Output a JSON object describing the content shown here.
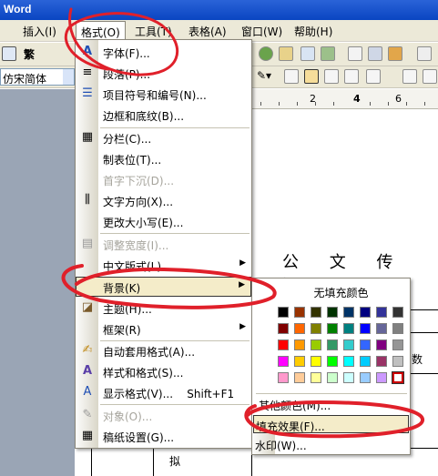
{
  "window": {
    "title": "Word"
  },
  "menubar": {
    "items": [
      {
        "label": "插入(I)"
      },
      {
        "label": "格式(O)"
      },
      {
        "label": "工具(T)"
      },
      {
        "label": "表格(A)"
      },
      {
        "label": "窗口(W)"
      },
      {
        "label": "帮助(H)"
      }
    ]
  },
  "toolbar": {
    "font_name": "仿宋简体",
    "trad_label": "繁"
  },
  "ruler": {
    "labels": [
      "2",
      "4",
      "6"
    ]
  },
  "format_menu": {
    "items": [
      {
        "label": "字体(F)...",
        "icon": "font-A-icon",
        "enabled": true
      },
      {
        "label": "段落(P)...",
        "icon": "paragraph-icon",
        "enabled": true
      },
      {
        "label": "项目符号和编号(N)...",
        "icon": "bullets-icon",
        "enabled": true
      },
      {
        "label": "边框和底纹(B)...",
        "icon": "",
        "enabled": true
      },
      {
        "label": "分栏(C)...",
        "icon": "columns-icon",
        "enabled": true
      },
      {
        "label": "制表位(T)...",
        "icon": "",
        "enabled": true
      },
      {
        "label": "首字下沉(D)...",
        "icon": "",
        "enabled": false
      },
      {
        "label": "文字方向(X)...",
        "icon": "text-direction-icon",
        "enabled": true
      },
      {
        "label": "更改大小写(E)...",
        "icon": "",
        "enabled": true
      },
      {
        "label": "调整宽度(I)...",
        "icon": "fit-width-icon",
        "enabled": false
      },
      {
        "label": "中文版式(L)",
        "icon": "",
        "enabled": true,
        "submenu": true
      },
      {
        "label": "背景(K)",
        "icon": "",
        "enabled": true,
        "submenu": true,
        "highlighted": true
      },
      {
        "label": "主题(H)...",
        "icon": "theme-icon",
        "enabled": true
      },
      {
        "label": "框架(R)",
        "icon": "",
        "enabled": true,
        "submenu": true
      },
      {
        "label": "自动套用格式(A)...",
        "icon": "autoformat-icon",
        "enabled": true
      },
      {
        "label": "样式和格式(S)...",
        "icon": "styles-icon",
        "enabled": true
      },
      {
        "label": "显示格式(V)...    Shift+F1",
        "icon": "reveal-format-icon",
        "enabled": true
      },
      {
        "label": "对象(O)...",
        "icon": "object-icon",
        "enabled": false
      },
      {
        "label": "稿纸设置(G)...",
        "icon": "draft-paper-icon",
        "enabled": true
      }
    ]
  },
  "background_menu": {
    "no_fill_label": "无填充颜色",
    "colors": [
      [
        "#000000",
        "#993300",
        "#333300",
        "#003300",
        "#003366",
        "#000080",
        "#333399",
        "#333333"
      ],
      [
        "#800000",
        "#ff6600",
        "#808000",
        "#008000",
        "#008080",
        "#0000ff",
        "#666699",
        "#808080"
      ],
      [
        "#ff0000",
        "#ff9900",
        "#99cc00",
        "#339966",
        "#33cccc",
        "#3366ff",
        "#800080",
        "#969696"
      ],
      [
        "#ff00ff",
        "#ffcc00",
        "#ffff00",
        "#00ff00",
        "#00ffff",
        "#00ccff",
        "#993366",
        "#c0c0c0"
      ],
      [
        "#ff99cc",
        "#ffcc99",
        "#ffff99",
        "#ccffcc",
        "#ccffff",
        "#99ccff",
        "#cc99ff",
        "#ffffff"
      ]
    ],
    "selected_color": "#ffffff",
    "more_colors_label": "其他颜色(M)...",
    "fill_effects_label": "填充效果(F)...",
    "watermark_label": "水印(W)..."
  },
  "document": {
    "heading": "公 文 传 阅",
    "cell_text": "数",
    "bottom_text": "拟"
  }
}
